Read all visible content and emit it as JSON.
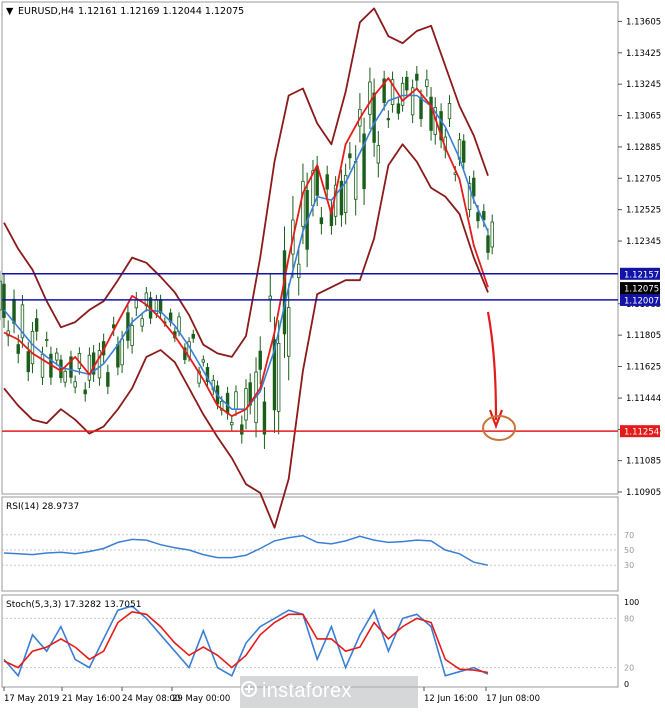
{
  "header": {
    "symbol": "EURUSD,H4",
    "ohlc": "1.12161 1.12169 1.12044 1.12075"
  },
  "chart_data": [
    {
      "type": "line",
      "panel": "price",
      "y_ticks": [
        "1.13605",
        "1.13425",
        "1.13245",
        "1.13065",
        "1.12885",
        "1.12705",
        "1.12525",
        "1.12345",
        "1.11985",
        "1.11805",
        "1.11625",
        "1.11444",
        "1.11264",
        "1.11085",
        "1.10905"
      ],
      "ylim": [
        1.10905,
        1.13705
      ],
      "hlines": [
        {
          "label": "1.12157",
          "value": 1.12157,
          "color": "#1313a8"
        },
        {
          "label": "1.12007",
          "value": 1.12007,
          "color": "#1313a8"
        },
        {
          "label": "1.11254",
          "value": 1.11254,
          "color": "#e51b1b"
        }
      ],
      "current_price": "1.12075",
      "series": [
        {
          "color": "#e51b1b",
          "values": [
            1.1182,
            1.1178,
            1.117,
            1.1165,
            1.116,
            1.1168,
            1.1158,
            1.1172,
            1.1188,
            1.1203,
            1.1198,
            1.119,
            1.118,
            1.1168,
            1.1155,
            1.114,
            1.1134,
            1.1138,
            1.115,
            1.1182,
            1.1225,
            1.1262,
            1.1278,
            1.125,
            1.129,
            1.1305,
            1.1318,
            1.1328,
            1.1315,
            1.1322,
            1.1312,
            1.1288,
            1.127,
            1.1232,
            1.1208
          ]
        },
        {
          "color": "#3a7fd5",
          "values": [
            1.1195,
            1.1185,
            1.1175,
            1.1168,
            1.1162,
            1.116,
            1.1158,
            1.1164,
            1.1175,
            1.1188,
            1.1195,
            1.1194,
            1.1186,
            1.1174,
            1.116,
            1.1146,
            1.1138,
            1.1138,
            1.1148,
            1.1172,
            1.1208,
            1.124,
            1.126,
            1.1258,
            1.1268,
            1.1285,
            1.1302,
            1.1315,
            1.1318,
            1.1318,
            1.1312,
            1.13,
            1.1282,
            1.1258,
            1.124
          ]
        }
      ],
      "bands": {
        "upper": [
          1.1245,
          1.123,
          1.1218,
          1.12,
          1.1185,
          1.1188,
          1.1195,
          1.12,
          1.1212,
          1.1225,
          1.1222,
          1.1214,
          1.1205,
          1.1192,
          1.1175,
          1.117,
          1.1168,
          1.118,
          1.1225,
          1.128,
          1.1318,
          1.1322,
          1.1302,
          1.129,
          1.132,
          1.136,
          1.1368,
          1.1352,
          1.1348,
          1.1355,
          1.1358,
          1.1335,
          1.1312,
          1.1295,
          1.1272
        ],
        "middle": [
          1.1195,
          1.1185,
          1.1175,
          1.1168,
          1.1162,
          1.116,
          1.1158,
          1.1164,
          1.1175,
          1.1188,
          1.1195,
          1.1194,
          1.1186,
          1.1174,
          1.116,
          1.1146,
          1.1138,
          1.1138,
          1.1148,
          1.1172,
          1.1208,
          1.124,
          1.126,
          1.1258,
          1.1268,
          1.1285,
          1.1302,
          1.1315,
          1.1318,
          1.1318,
          1.1312,
          1.13,
          1.1282,
          1.1258,
          1.124
        ],
        "lower": [
          1.115,
          1.114,
          1.1132,
          1.113,
          1.1138,
          1.1132,
          1.1124,
          1.1128,
          1.1138,
          1.115,
          1.1168,
          1.1172,
          1.1165,
          1.115,
          1.1135,
          1.1122,
          1.111,
          1.1095,
          1.109,
          1.107,
          1.1098,
          1.116,
          1.1204,
          1.1208,
          1.1212,
          1.1212,
          1.1236,
          1.1278,
          1.129,
          1.128,
          1.1265,
          1.126,
          1.125,
          1.1225,
          1.1205
        ]
      }
    },
    {
      "type": "line",
      "panel": "rsi",
      "label": "RSI(14) 28.9737",
      "levels": [
        "70",
        "50",
        "30"
      ],
      "ylim": [
        0,
        100
      ],
      "values": [
        46,
        45,
        44,
        46,
        47,
        45,
        48,
        52,
        60,
        64,
        63,
        57,
        53,
        50,
        44,
        40,
        40,
        43,
        52,
        62,
        66,
        69,
        60,
        58,
        62,
        68,
        63,
        60,
        61,
        63,
        62,
        50,
        45,
        34,
        30
      ]
    },
    {
      "type": "line",
      "panel": "stochastic",
      "label": "Stoch(5,3,3) 17.3282 13.7051",
      "levels": [
        "100",
        "80",
        "20",
        "0"
      ],
      "ylim": [
        0,
        100
      ],
      "series": [
        {
          "color": "#3a7fd5",
          "values": [
            30,
            10,
            60,
            40,
            70,
            30,
            20,
            55,
            90,
            95,
            80,
            60,
            40,
            20,
            65,
            20,
            10,
            50,
            70,
            80,
            90,
            85,
            30,
            70,
            20,
            60,
            90,
            40,
            80,
            85,
            70,
            10,
            15,
            20,
            12
          ]
        },
        {
          "color": "#e51b1b",
          "values": [
            28,
            20,
            40,
            45,
            55,
            45,
            30,
            40,
            75,
            88,
            85,
            70,
            50,
            35,
            45,
            35,
            20,
            35,
            60,
            75,
            85,
            85,
            55,
            55,
            40,
            45,
            75,
            55,
            70,
            80,
            75,
            30,
            18,
            17,
            14
          ]
        }
      ]
    }
  ],
  "x_axis": {
    "ticks": [
      "17 May 2019",
      "21 May 16:00",
      "24 May 08:00",
      "29 May 00:00",
      "12 Jun 16:00",
      "17 Jun 08:00"
    ]
  },
  "watermark": {
    "text": "instaforex"
  }
}
